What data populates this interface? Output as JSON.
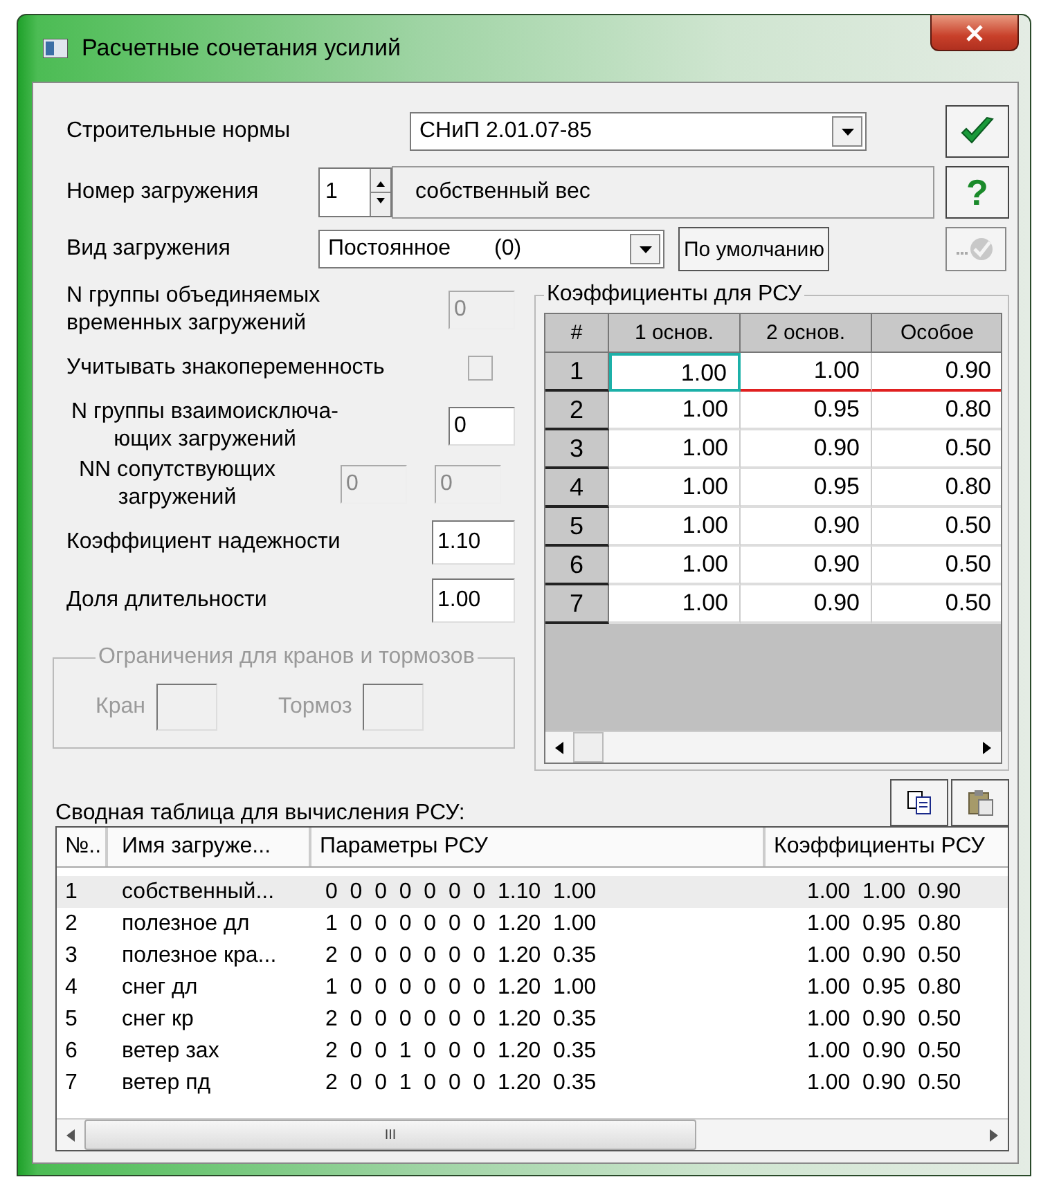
{
  "window": {
    "title": "Расчетные сочетания усилий"
  },
  "norms": {
    "label": "Строительные нормы",
    "value": "СНиП 2.01.07-85"
  },
  "load_number": {
    "label": "Номер загружения",
    "value": "1",
    "name": "собственный вес"
  },
  "load_type": {
    "label": "Вид загружения",
    "value": "Постоянное",
    "code": "(0)",
    "default_button": "По умолчанию",
    "apply_disabled": true
  },
  "help_button": "?",
  "group_combined": {
    "label": "N группы объединяемых временных загружений",
    "value": "0",
    "disabled": true
  },
  "sign_variable": {
    "label": "Учитывать знакопеременность",
    "checked": false,
    "disabled": true
  },
  "group_exclusive": {
    "label": "N группы взаимоисключа-ющих загружений",
    "value": "0",
    "disabled": false
  },
  "accompanying": {
    "label": "NN сопутствующих загружений",
    "values": [
      "0",
      "0"
    ],
    "disabled": true
  },
  "reliability": {
    "label": "Коэффициент надежности",
    "value": "1.10"
  },
  "duration": {
    "label": "Доля длительности",
    "value": "1.00"
  },
  "crane_group": {
    "title": "Ограничения для кранов и тормозов",
    "disabled": true,
    "crane_label": "Кран",
    "brake_label": "Тормоз"
  },
  "coefficients": {
    "title": "Коэффициенты для РСУ",
    "columns": [
      "#",
      "1 основ.",
      "2 основ.",
      "Особое"
    ],
    "rows": [
      {
        "index": "1",
        "values": [
          "1.00",
          "1.00",
          "0.90"
        ],
        "selected": true
      },
      {
        "index": "2",
        "values": [
          "1.00",
          "0.95",
          "0.80"
        ],
        "selected": false
      },
      {
        "index": "3",
        "values": [
          "1.00",
          "0.90",
          "0.50"
        ],
        "selected": false
      },
      {
        "index": "4",
        "values": [
          "1.00",
          "0.95",
          "0.80"
        ],
        "selected": false
      },
      {
        "index": "5",
        "values": [
          "1.00",
          "0.90",
          "0.50"
        ],
        "selected": false
      },
      {
        "index": "6",
        "values": [
          "1.00",
          "0.90",
          "0.50"
        ],
        "selected": false
      },
      {
        "index": "7",
        "values": [
          "1.00",
          "0.90",
          "0.50"
        ],
        "selected": false
      }
    ]
  },
  "summary": {
    "title": "Сводная таблица для вычисления РСУ:",
    "columns": [
      "№..",
      "Имя загруже...",
      "Параметры РСУ",
      "Коэффициенты РСУ"
    ],
    "rows": [
      {
        "number": "1",
        "name": "собственный...",
        "params": "0  0  0  0  0  0  0  1.10  1.00",
        "coeffs": "1.00  1.00  0.90",
        "selected": true
      },
      {
        "number": "2",
        "name": "полезное дл",
        "params": "1  0  0  0  0  0  0  1.20  1.00",
        "coeffs": "1.00  0.95  0.80",
        "selected": false
      },
      {
        "number": "3",
        "name": "полезное кра...",
        "params": "2  0  0  0  0  0  0  1.20  0.35",
        "coeffs": "1.00  0.90  0.50",
        "selected": false
      },
      {
        "number": "4",
        "name": "снег дл",
        "params": "1  0  0  0  0  0  0  1.20  1.00",
        "coeffs": "1.00  0.95  0.80",
        "selected": false
      },
      {
        "number": "5",
        "name": "снег кр",
        "params": "2  0  0  0  0  0  0  1.20  0.35",
        "coeffs": "1.00  0.90  0.50",
        "selected": false
      },
      {
        "number": "6",
        "name": "ветер зах",
        "params": "2  0  0  1  0  0  0  1.20  0.35",
        "coeffs": "1.00  0.90  0.50",
        "selected": false
      },
      {
        "number": "7",
        "name": "ветер пд",
        "params": "2  0  0  1  0  0  0  1.20  0.35",
        "coeffs": "1.00  0.90  0.50",
        "selected": false
      }
    ]
  },
  "scroll_grip": "III"
}
